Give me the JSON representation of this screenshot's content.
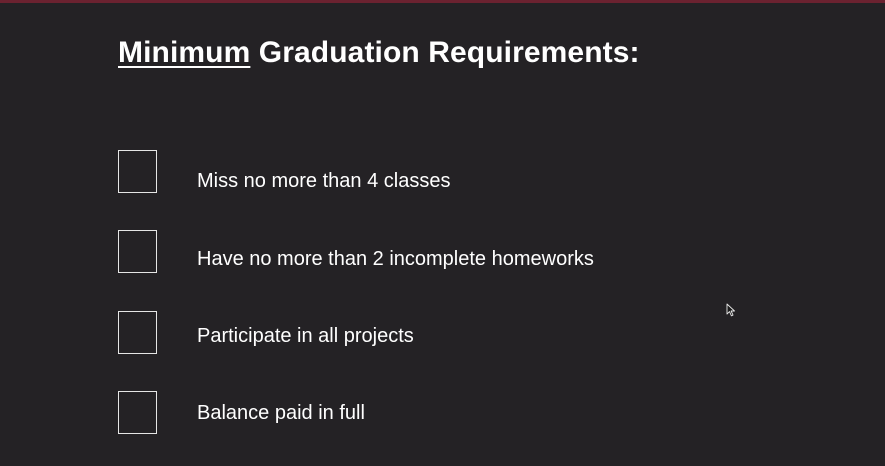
{
  "title": {
    "emphasis": "Minimum",
    "rest": " Graduation Requirements:"
  },
  "requirements": [
    {
      "label": "Miss no more than 4 classes",
      "checked": false
    },
    {
      "label": "Have no more than 2 incomplete homeworks",
      "checked": false
    },
    {
      "label": "Participate in all projects",
      "checked": false
    },
    {
      "label": "Balance paid in full",
      "checked": false
    }
  ],
  "colors": {
    "background": "#242225",
    "text": "#ffffff",
    "top_rule": "#6b2230",
    "checkbox_border": "#e6e6e6"
  },
  "icons": {
    "pointer": "mouse-pointer-icon"
  }
}
